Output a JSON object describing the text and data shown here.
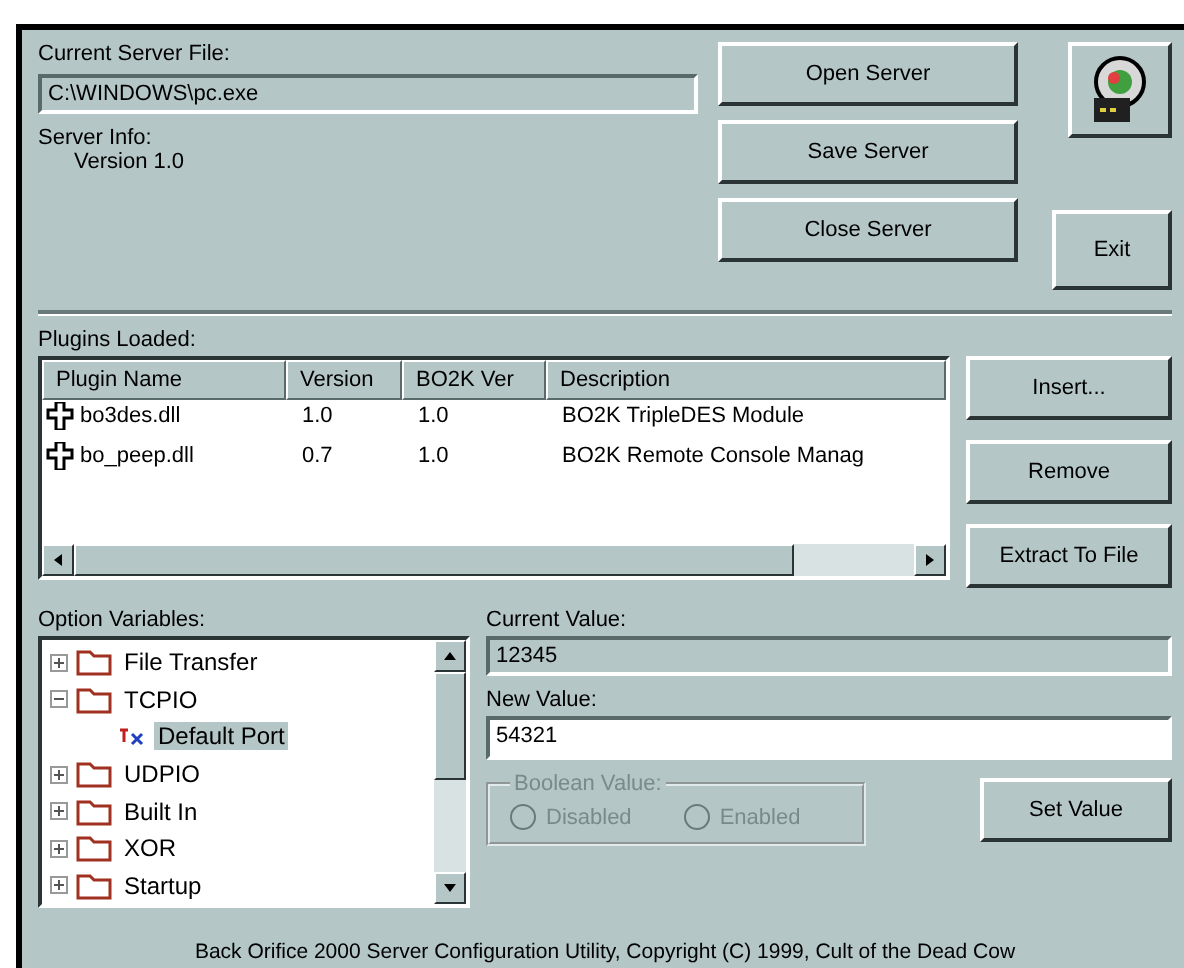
{
  "server_file": {
    "label": "Current Server File:",
    "value": "C:\\WINDOWS\\pc.exe"
  },
  "server_info": {
    "label": "Server Info:",
    "version": "Version 1.0"
  },
  "server_buttons": [
    "Open Server",
    "Save Server",
    "Close Server"
  ],
  "exit_button": "Exit",
  "plugins": {
    "label": "Plugins Loaded:",
    "columns": [
      "Plugin Name",
      "Version",
      "BO2K Ver",
      "Description"
    ],
    "rows": [
      [
        "bo3des.dll",
        "1.0",
        "1.0",
        "BO2K TripleDES Module"
      ],
      [
        "bo_peep.dll",
        "0.7",
        "1.0",
        "BO2K Remote Console Manag"
      ]
    ]
  },
  "plugin_buttons": [
    "Insert...",
    "Remove",
    "Extract To File"
  ],
  "options": {
    "label": "Option Variables:",
    "items": [
      {
        "label": "File Transfer",
        "expanded": false,
        "selected": false
      },
      {
        "label": "TCPIO",
        "expanded": true,
        "selected": false,
        "children": [
          {
            "label": "Default Port",
            "selected": true
          }
        ]
      },
      {
        "label": "UDPIO",
        "expanded": false,
        "selected": false
      },
      {
        "label": "Built In",
        "expanded": false,
        "selected": false
      },
      {
        "label": "XOR",
        "expanded": false,
        "selected": false
      },
      {
        "label": "Startup",
        "expanded": false,
        "selected": false
      }
    ]
  },
  "current_value": {
    "label": "Current Value:",
    "value": "12345"
  },
  "new_value": {
    "label": "New Value:",
    "value": "54321"
  },
  "boolean": {
    "label": "Boolean Value:",
    "disabled": true,
    "options": [
      {
        "label": "Disabled",
        "selected": false
      },
      {
        "label": "Enabled",
        "selected": false
      }
    ]
  },
  "set_button": "Set Value",
  "status_bar": "Back Orifice 2000 Server Configuration Utility, Copyright (C) 1999, Cult of the Dead Cow"
}
